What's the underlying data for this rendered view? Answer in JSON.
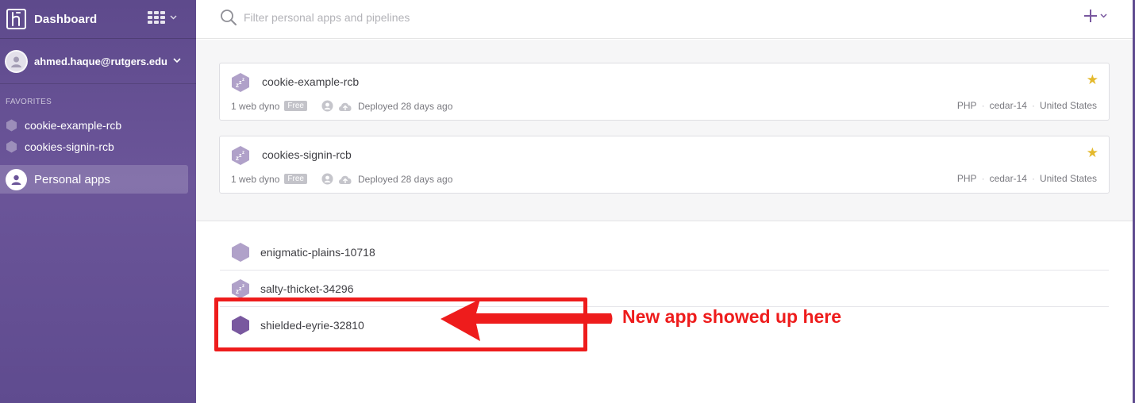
{
  "sidebar": {
    "title": "Dashboard",
    "user_email": "ahmed.haque@rutgers.edu",
    "favorites_label": "FAVORITES",
    "favorites": [
      {
        "name": "cookie-example-rcb"
      },
      {
        "name": "cookies-signin-rcb"
      }
    ],
    "active_nav": "Personal apps"
  },
  "search": {
    "placeholder": "Filter personal apps and pipelines"
  },
  "favorite_cards": [
    {
      "name": "cookie-example-rcb",
      "dynos": "1 web dyno",
      "tier": "Free",
      "deployed": "Deployed 28 days ago",
      "language": "PHP",
      "stack": "cedar-14",
      "region": "United States",
      "starred": true
    },
    {
      "name": "cookies-signin-rcb",
      "dynos": "1 web dyno",
      "tier": "Free",
      "deployed": "Deployed 28 days ago",
      "language": "PHP",
      "stack": "cedar-14",
      "region": "United States",
      "starred": true
    }
  ],
  "apps": [
    {
      "name": "enigmatic-plains-10718",
      "icon": "hexagon-icon"
    },
    {
      "name": "salty-thicket-34296",
      "icon": "sleeping-hexagon-icon"
    },
    {
      "name": "shielded-eyrie-32810",
      "icon": "hexagon-icon"
    }
  ],
  "annotation": {
    "text": "New app showed up here",
    "color": "#ee1c1c"
  },
  "colors": {
    "sidebar": "#5e4a8c",
    "accent": "#79589f",
    "star": "#e4b92c"
  }
}
